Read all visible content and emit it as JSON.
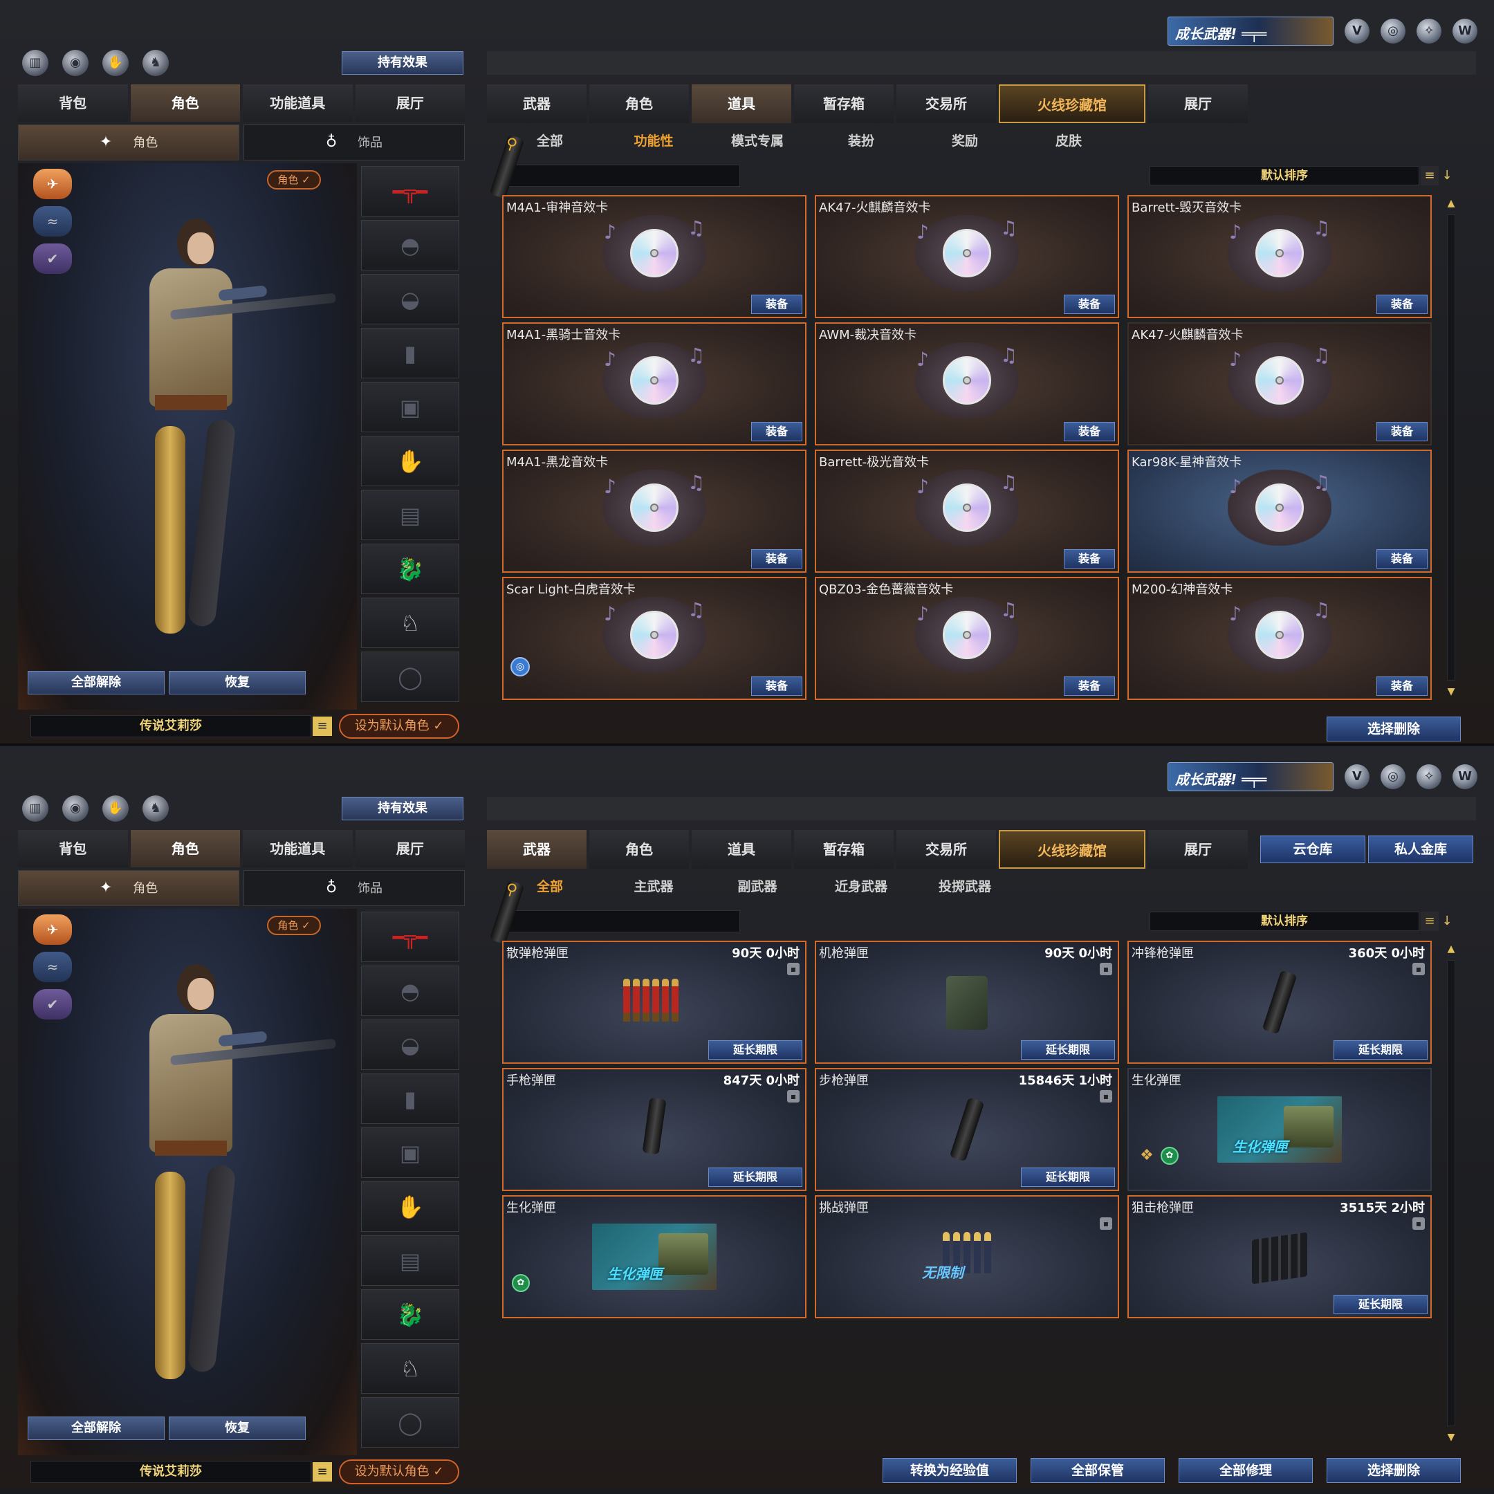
{
  "common": {
    "growth_banner": "成长武器!",
    "right_icons": [
      "shield-v-icon",
      "globe-icon",
      "compass-icon",
      "v-wing-icon"
    ],
    "left_icons": [
      "ranking-icon",
      "eye-icon",
      "hand-icon",
      "wolf-icon"
    ],
    "effect_button": "持有效果",
    "left_tabs": [
      "背包",
      "角色",
      "功能道具",
      "展厅"
    ],
    "left_active_tab": 1,
    "left_subtabs": [
      {
        "icon": "✦",
        "label": "角色"
      },
      {
        "icon": "♁",
        "label": "饰品"
      }
    ],
    "role_badge": "角色 ✓",
    "unequip_all": "全部解除",
    "restore": "恢复",
    "char_name": "传说艾莉莎",
    "set_default": "设为默认角色 ✓",
    "right_tabs": [
      "武器",
      "角色",
      "道具",
      "暂存箱",
      "交易所",
      "火线珍藏馆",
      "展厅"
    ],
    "sort_label": "默认排序"
  },
  "top": {
    "active_tab": 2,
    "subtabs": [
      "全部",
      "功能性",
      "模式专属",
      "装扮",
      "奖励",
      "皮肤"
    ],
    "active_subtab": 1,
    "cards": [
      {
        "name": "M4A1-审神音效卡",
        "button": "装备"
      },
      {
        "name": "AK47-火麒麟音效卡",
        "button": "装备"
      },
      {
        "name": "Barrett-毁灭音效卡",
        "button": "装备"
      },
      {
        "name": "M4A1-黑骑士音效卡",
        "button": "装备"
      },
      {
        "name": "AWM-裁决音效卡",
        "button": "装备"
      },
      {
        "name": "AK47-火麒麟音效卡",
        "button": "装备"
      },
      {
        "name": "M4A1-黑龙音效卡",
        "button": "装备"
      },
      {
        "name": "Barrett-极光音效卡",
        "button": "装备"
      },
      {
        "name": "Kar98K-星神音效卡",
        "button": "装备"
      },
      {
        "name": "Scar Light-白虎音效卡",
        "button": "装备"
      },
      {
        "name": "QBZ03-金色蔷薇音效卡",
        "button": "装备"
      },
      {
        "name": "M200-幻神音效卡",
        "button": "装备"
      }
    ],
    "delete_button": "选择删除"
  },
  "bottom": {
    "active_tab": 0,
    "cloud_buttons": [
      "云仓库",
      "私人金库"
    ],
    "subtabs": [
      "全部",
      "主武器",
      "副武器",
      "近身武器",
      "投掷武器"
    ],
    "active_subtab": 0,
    "cards": [
      {
        "name": "散弹枪弹匣",
        "time": "90天 0小时",
        "button": "延长期限"
      },
      {
        "name": "机枪弹匣",
        "time": "90天 0小时",
        "button": "延长期限"
      },
      {
        "name": "冲锋枪弹匣",
        "time": "360天 0小时",
        "button": "延长期限"
      },
      {
        "name": "手枪弹匣",
        "time": "847天 0小时",
        "button": "延长期限"
      },
      {
        "name": "步枪弹匣",
        "time": "15846天 1小时",
        "button": "延长期限"
      },
      {
        "name": "生化弹匣",
        "time": "",
        "button": "",
        "image_text": "生化弹匣"
      },
      {
        "name": "生化弹匣",
        "time": "",
        "button": "",
        "image_text": "生化弹匣"
      },
      {
        "name": "挑战弹匣",
        "time": "",
        "button": "",
        "image_text": "无限制"
      },
      {
        "name": "狙击枪弹匣",
        "time": "3515天 2小时",
        "button": "延长期限"
      }
    ],
    "actions": [
      "转换为经验值",
      "全部保管",
      "全部修理",
      "选择删除"
    ]
  }
}
